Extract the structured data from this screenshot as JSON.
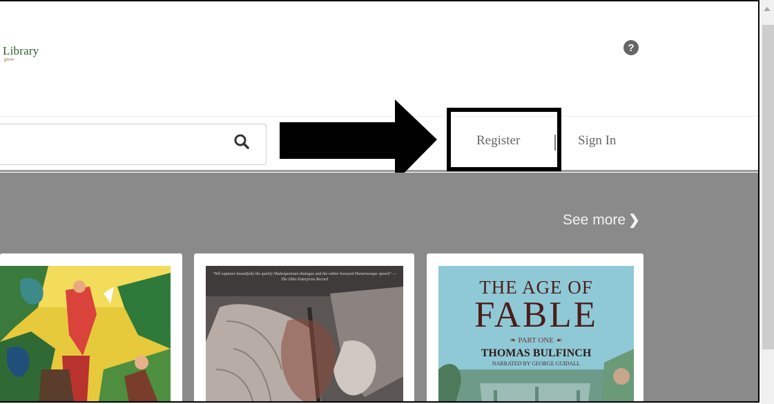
{
  "header": {
    "logo_text": "Library",
    "logo_tagline": "grow",
    "help_icon": "question-circle-icon",
    "help_symbol": "?"
  },
  "search": {
    "placeholder": "",
    "icon": "magnifier-icon"
  },
  "account": {
    "register_label": "Register",
    "signin_label": "Sign In"
  },
  "annotation": {
    "arrow_icon": "right-arrow-icon",
    "highlight_color": "#000000"
  },
  "featured": {
    "see_more_label": "See more",
    "see_more_icon": "chevron-right-icon",
    "band_color": "#8a8a8a",
    "books": [
      {
        "cover_quote": "",
        "title_line1": "",
        "title_line2": "",
        "part": "",
        "author": "",
        "narrator": ""
      },
      {
        "cover_quote": "\"Tell captures beautifully the quietly Shakespearean dialogue and the rather honeyed Homeroesque speech\" — The Ohio Enterprise Record",
        "title_line1": "",
        "title_line2": "",
        "part": "",
        "author": "",
        "narrator": ""
      },
      {
        "cover_quote": "",
        "title_line1": "THE AGE OF",
        "title_line2": "FABLE",
        "part": "PART ONE",
        "author": "THOMAS BULFINCH",
        "narrator": "NARRATED BY GEORGE GUIDALL"
      }
    ]
  }
}
